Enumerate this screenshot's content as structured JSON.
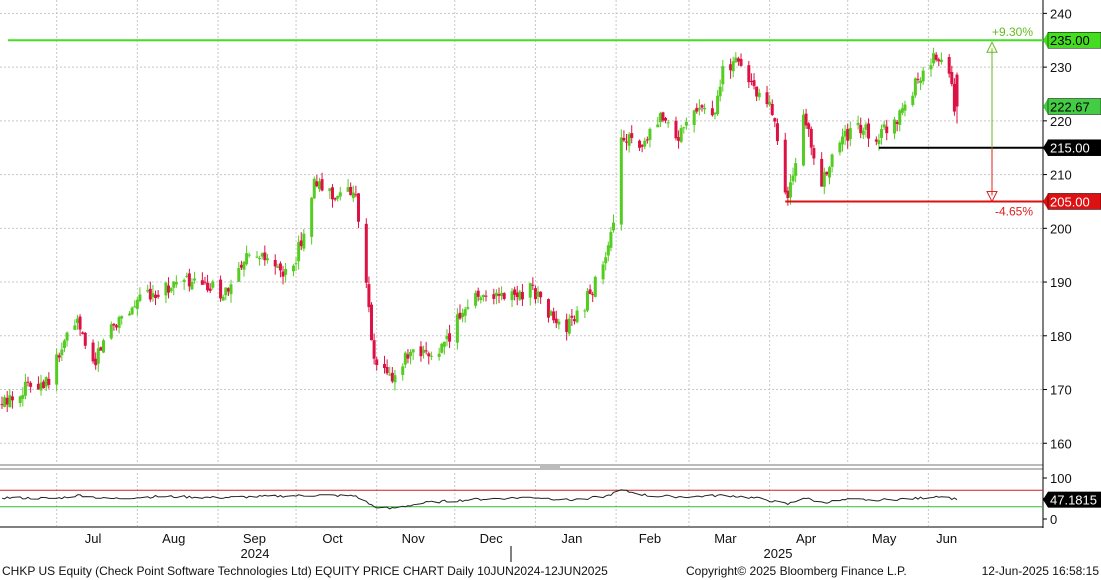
{
  "footer": {
    "left": "CHKP US Equity (Check Point Software Technologies Ltd) EQUITY PRICE CHART  Daily 10JUN2024-12JUN2025",
    "middle": "Copyright© 2025 Bloomberg Finance L.P.",
    "right": "12-Jun-2025 16:58:15"
  },
  "colors": {
    "up": "#55cc22",
    "down": "#dd1144",
    "grid": "#c8c8c8",
    "rsi_line": "#222222",
    "rsi_upper": "#cc2222",
    "rsi_lower": "#33bb33",
    "hline_235": "#44dd22",
    "hline_215": "#000000",
    "hline_205": "#dd1111",
    "current_tag": "#44cc44"
  },
  "chart_data": [
    {
      "type": "candlestick",
      "title": "",
      "y_axis_position": "right",
      "ylim": [
        157,
        242
      ],
      "yticks": [
        160,
        170,
        180,
        190,
        200,
        210,
        220,
        230,
        240
      ],
      "x_range": [
        "2024-06-10",
        "2025-06-12"
      ],
      "month_labels": [
        "Jul",
        "Aug",
        "Sep",
        "Oct",
        "Nov",
        "Dec",
        "Jan",
        "Feb",
        "Mar",
        "Apr",
        "May",
        "Jun"
      ],
      "year_labels": [
        "2024",
        "2025"
      ],
      "last_price": 222.67,
      "last_price_label": "222.67",
      "horizontal_lines": [
        {
          "value": 235.0,
          "label": "235.00",
          "color": "#44dd22"
        },
        {
          "value": 215.0,
          "label": "215.00",
          "color": "#000000"
        },
        {
          "value": 205.0,
          "label": "205.00",
          "color": "#dd1111"
        }
      ],
      "annotations": [
        {
          "text": "+9.30%",
          "color": "#66bb22"
        },
        {
          "text": "-4.65%",
          "color": "#dd2222"
        }
      ],
      "anchors": [
        [
          "2024-06-10",
          167
        ],
        [
          "2024-06-20",
          171
        ],
        [
          "2024-06-28",
          172
        ],
        [
          "2024-07-08",
          183
        ],
        [
          "2024-07-15",
          175
        ],
        [
          "2024-07-22",
          182
        ],
        [
          "2024-08-05",
          188
        ],
        [
          "2024-08-20",
          190
        ],
        [
          "2024-08-27",
          189
        ],
        [
          "2024-09-05",
          188
        ],
        [
          "2024-09-12",
          194
        ],
        [
          "2024-09-20",
          194
        ],
        [
          "2024-09-27",
          191
        ],
        [
          "2024-10-02",
          196
        ],
        [
          "2024-10-08",
          208
        ],
        [
          "2024-10-18",
          206
        ],
        [
          "2024-10-24",
          207
        ],
        [
          "2024-10-31",
          175
        ],
        [
          "2024-11-06",
          172
        ],
        [
          "2024-11-13",
          176
        ],
        [
          "2024-11-20",
          176
        ],
        [
          "2024-11-27",
          178
        ],
        [
          "2024-12-05",
          186
        ],
        [
          "2024-12-12",
          188
        ],
        [
          "2024-12-20",
          187
        ],
        [
          "2024-12-31",
          189
        ],
        [
          "2025-01-06",
          184
        ],
        [
          "2025-01-13",
          181
        ],
        [
          "2025-01-20",
          186
        ],
        [
          "2025-01-27",
          193
        ],
        [
          "2025-02-02",
          203
        ],
        [
          "2025-02-03",
          218
        ],
        [
          "2025-02-10",
          214
        ],
        [
          "2025-02-18",
          220
        ],
        [
          "2025-02-25",
          217
        ],
        [
          "2025-03-04",
          223
        ],
        [
          "2025-03-11",
          221
        ],
        [
          "2025-03-14",
          230
        ],
        [
          "2025-03-21",
          231
        ],
        [
          "2025-03-28",
          224
        ],
        [
          "2025-04-02",
          222
        ],
        [
          "2025-04-08",
          205
        ],
        [
          "2025-04-14",
          221
        ],
        [
          "2025-04-21",
          208
        ],
        [
          "2025-04-28",
          216
        ],
        [
          "2025-05-05",
          219
        ],
        [
          "2025-05-12",
          217
        ],
        [
          "2025-05-19",
          220
        ],
        [
          "2025-05-26",
          226
        ],
        [
          "2025-06-02",
          231
        ],
        [
          "2025-06-05",
          232
        ],
        [
          "2025-06-09",
          228
        ],
        [
          "2025-06-11",
          223
        ],
        [
          "2025-06-12",
          222.67
        ]
      ]
    },
    {
      "type": "line",
      "name": "RSI",
      "ylim": [
        -5,
        105
      ],
      "yticks": [
        0,
        50,
        100
      ],
      "reference_lines": [
        70,
        30
      ],
      "last_value": 47.1815,
      "last_value_label": "47.1815",
      "anchors": [
        [
          "2024-06-10",
          52
        ],
        [
          "2024-07-01",
          50
        ],
        [
          "2024-07-10",
          58
        ],
        [
          "2024-07-20",
          49
        ],
        [
          "2024-08-10",
          55
        ],
        [
          "2024-09-01",
          52
        ],
        [
          "2024-09-20",
          55
        ],
        [
          "2024-10-10",
          58
        ],
        [
          "2024-10-24",
          56
        ],
        [
          "2024-10-31",
          30
        ],
        [
          "2024-11-06",
          25
        ],
        [
          "2024-11-20",
          40
        ],
        [
          "2024-12-10",
          48
        ],
        [
          "2024-12-31",
          53
        ],
        [
          "2025-01-14",
          46
        ],
        [
          "2025-01-28",
          55
        ],
        [
          "2025-02-03",
          70
        ],
        [
          "2025-02-14",
          56
        ],
        [
          "2025-03-01",
          54
        ],
        [
          "2025-03-15",
          58
        ],
        [
          "2025-03-28",
          50
        ],
        [
          "2025-04-08",
          36
        ],
        [
          "2025-04-14",
          52
        ],
        [
          "2025-04-21",
          40
        ],
        [
          "2025-05-01",
          47
        ],
        [
          "2025-05-15",
          47
        ],
        [
          "2025-05-28",
          50
        ],
        [
          "2025-06-05",
          56
        ],
        [
          "2025-06-09",
          52
        ],
        [
          "2025-06-12",
          47.18
        ]
      ]
    }
  ]
}
